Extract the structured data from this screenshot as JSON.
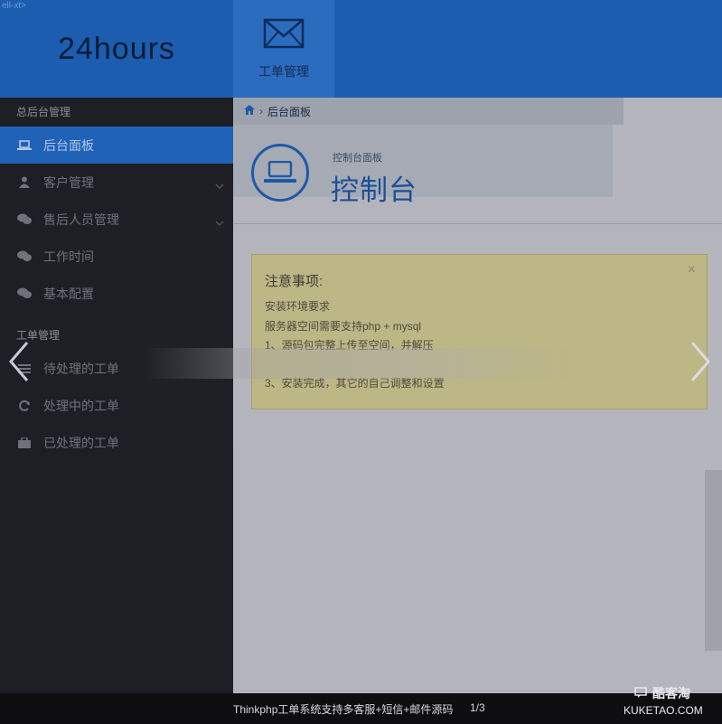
{
  "header": {
    "brand_tag": "ell-xt>",
    "brand": "24hours",
    "nav_item": "工单管理"
  },
  "sidebar": {
    "section1": "总后台管理",
    "items1": [
      {
        "label": "后台面板",
        "icon": "laptop-icon",
        "active": true
      },
      {
        "label": "客户管理",
        "icon": "user-icon"
      },
      {
        "label": "售后人员管理",
        "icon": "comments-icon"
      },
      {
        "label": "工作时间",
        "icon": "comments-icon"
      },
      {
        "label": "基本配置",
        "icon": "comments-icon"
      }
    ],
    "section2": "工单管理",
    "items2": [
      {
        "label": "待处理的工单",
        "icon": "list-icon"
      },
      {
        "label": "处理中的工单",
        "icon": "refresh-icon"
      },
      {
        "label": "已处理的工单",
        "icon": "briefcase-icon"
      }
    ]
  },
  "breadcrumb": {
    "current": "后台面板"
  },
  "page": {
    "subtitle": "控制台面板",
    "title": "控制台"
  },
  "notice": {
    "title": "注意事项:",
    "close": "×",
    "lines": [
      "安装环境要求",
      "服务器空间需要支持php + mysql",
      "1、源码包完整上传至空间，并解压",
      "3、安装完成，其它的自己调整和设置"
    ]
  },
  "caption": {
    "text": "Thinkphp工单系统支持多客服+短信+邮件源码",
    "pager": "1/3"
  },
  "watermark": {
    "name": "酷客淘",
    "domain": "KUKETAO.COM"
  },
  "colors": {
    "primary": "#1d5db0",
    "sidebar": "#1e1f24",
    "active": "#1f62b8",
    "notice": "#bdb685"
  }
}
